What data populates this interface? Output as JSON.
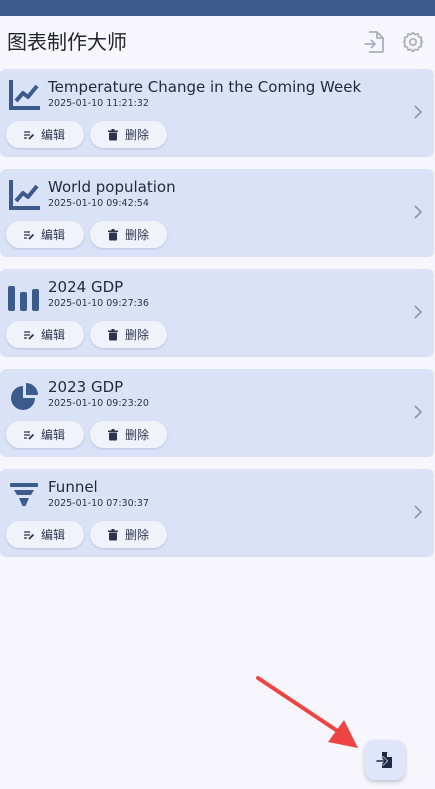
{
  "app": {
    "title": "图表制作大师"
  },
  "header": {
    "import_icon": "file-import-icon",
    "settings_icon": "gear-icon"
  },
  "colors": {
    "accent": "#3c5a8c",
    "card_bg": "#dae2f8",
    "page_bg": "#f6f6fc",
    "annotation_arrow": "#ef4444"
  },
  "actions": {
    "edit_label": "编辑",
    "delete_label": "删除"
  },
  "charts": [
    {
      "title": "Temperature Change in the Coming Week",
      "date": "2025-01-10 11:21:32",
      "icon": "line-chart-icon"
    },
    {
      "title": "World population",
      "date": "2025-01-10 09:42:54",
      "icon": "line-chart-icon"
    },
    {
      "title": "2024 GDP",
      "date": "2025-01-10 09:27:36",
      "icon": "bar-chart-icon"
    },
    {
      "title": "2023 GDP",
      "date": "2025-01-10 09:23:20",
      "icon": "pie-chart-icon"
    },
    {
      "title": "Funnel",
      "date": "2025-01-10 07:30:37",
      "icon": "funnel-chart-icon"
    }
  ],
  "fab": {
    "icon": "file-import-icon"
  }
}
